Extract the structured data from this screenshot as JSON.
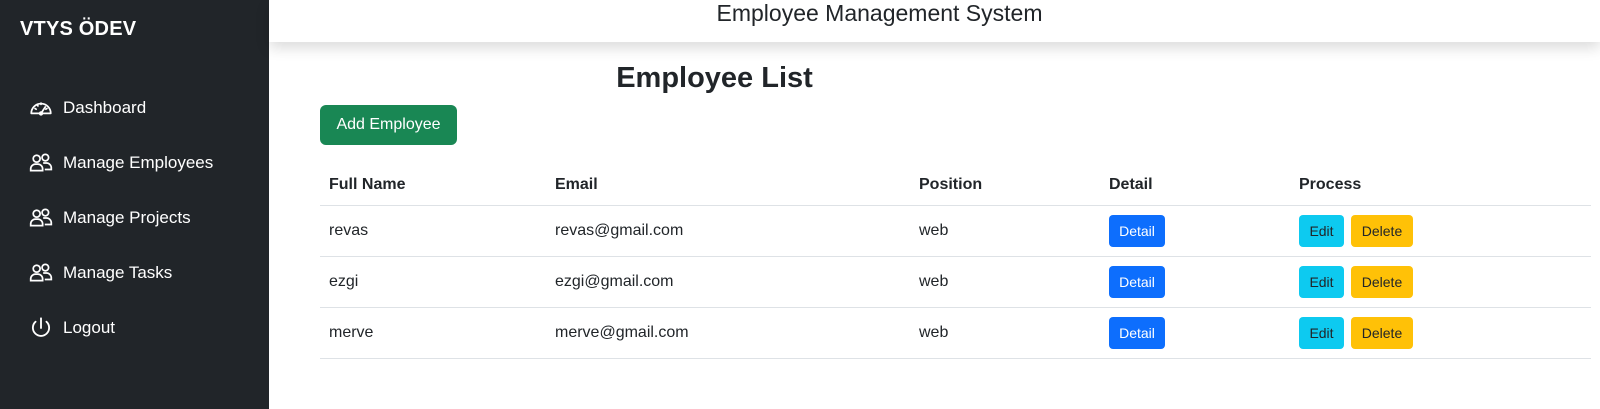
{
  "sidebar": {
    "brand": "VTYS ÖDEV",
    "items": [
      {
        "label": "Dashboard",
        "icon": "speedometer-icon"
      },
      {
        "label": "Manage Employees",
        "icon": "people-icon"
      },
      {
        "label": "Manage Projects",
        "icon": "people-icon"
      },
      {
        "label": "Manage Tasks",
        "icon": "people-icon"
      },
      {
        "label": "Logout",
        "icon": "power-icon"
      }
    ]
  },
  "header": {
    "title": "Employee Management System"
  },
  "main": {
    "heading": "Employee List",
    "add_button": "Add Employee",
    "columns": [
      "Full Name",
      "Email",
      "Position",
      "Detail",
      "Process"
    ],
    "rows": [
      {
        "name": "revas",
        "email": "revas@gmail.com",
        "position": "web"
      },
      {
        "name": "ezgi",
        "email": "ezgi@gmail.com",
        "position": "web"
      },
      {
        "name": "merve",
        "email": "merve@gmail.com",
        "position": "web"
      }
    ],
    "detail_label": "Detail",
    "edit_label": "Edit",
    "delete_label": "Delete"
  },
  "colors": {
    "sidebar_bg": "#212529",
    "success": "#198754",
    "primary": "#0d6efd",
    "info": "#0dcaf0",
    "warning": "#ffc107"
  }
}
